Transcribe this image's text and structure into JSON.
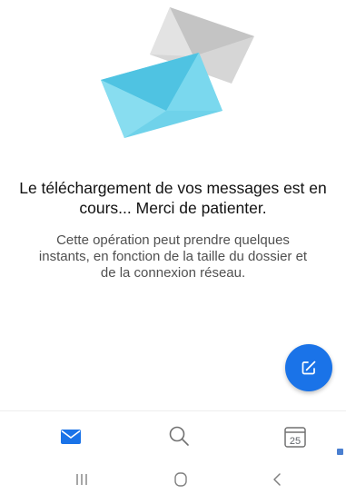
{
  "message": {
    "headline": "Le téléchargement de vos messages est en cours... Merci de patienter.",
    "body": "Cette opération peut prendre quelques instants, en fonction de la taille du dossier et de la connexion réseau."
  },
  "fab": {
    "icon": "compose-icon",
    "color": "#1a73e8"
  },
  "bottom_nav": {
    "items": [
      {
        "icon": "mail-icon",
        "active": true,
        "color": "#1a73e8"
      },
      {
        "icon": "search-icon",
        "active": false
      },
      {
        "icon": "calendar-icon",
        "active": false,
        "day": "25"
      }
    ]
  },
  "system_nav": {
    "items": [
      "recent-apps-icon",
      "home-icon",
      "back-icon"
    ]
  },
  "colors": {
    "accent": "#1a73e8",
    "envelope_front": "#6ed4ec",
    "envelope_back": "#d9d9d9"
  }
}
